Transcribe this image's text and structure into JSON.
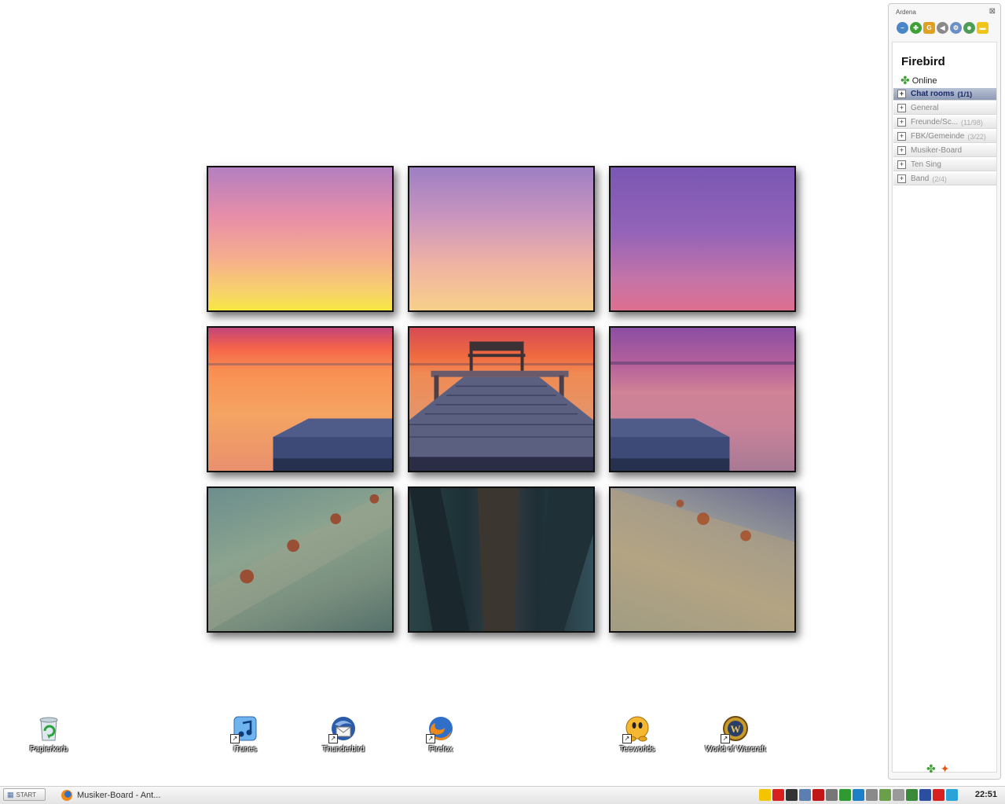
{
  "desktop": {
    "icons": [
      {
        "label": "Papierkorb",
        "icon": "recycle-bin-icon"
      },
      {
        "label": "iTunes",
        "icon": "itunes-icon"
      },
      {
        "label": "Thunderbird",
        "icon": "thunderbird-icon"
      },
      {
        "label": "Firefox",
        "icon": "firefox-icon"
      },
      {
        "label": "Teeworlds",
        "icon": "teeworlds-icon"
      },
      {
        "label": "World of Warcraft",
        "icon": "world-of-warcraft-icon"
      }
    ]
  },
  "messenger": {
    "window_title": "Ardena",
    "close_glyph": "⊠",
    "user": {
      "name": "Firebird",
      "status": "Online"
    },
    "groups": [
      {
        "name": "Chat rooms",
        "count": "(1/1)",
        "selected": true
      },
      {
        "name": "General",
        "count": "",
        "selected": false
      },
      {
        "name": "Freunde/Sc...",
        "count": "(11/98)",
        "selected": false
      },
      {
        "name": "FBK/Gemeinde",
        "count": "(3/22)",
        "selected": false
      },
      {
        "name": "Musiker-Board",
        "count": "",
        "selected": false
      },
      {
        "name": "Ten Sing",
        "count": "",
        "selected": false
      },
      {
        "name": "Band",
        "count": "(2/4)",
        "selected": false
      }
    ],
    "expand_glyph": "+"
  },
  "taskbar": {
    "start_label": "START",
    "task_label": "Musiker-Board - Ant...",
    "clock": "22:51"
  },
  "colors": {
    "selected_group": "#8e9bb5",
    "panel_bg": "#f7f7f7"
  }
}
